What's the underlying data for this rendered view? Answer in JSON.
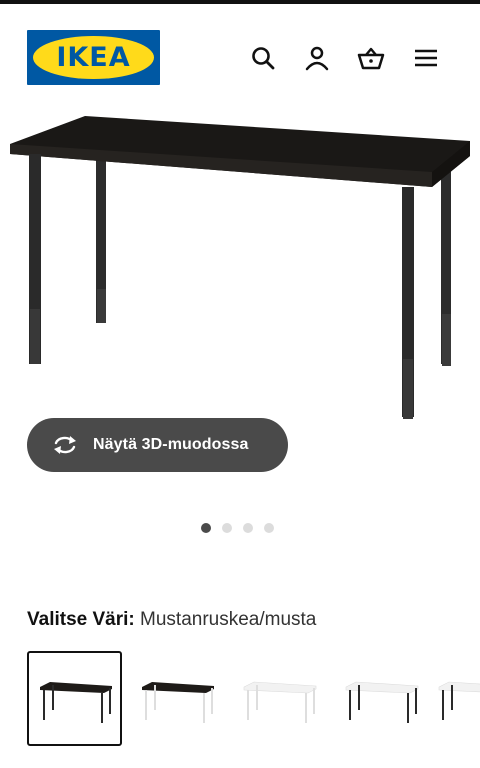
{
  "header": {
    "logo_text": "IKEA",
    "icons": [
      "search-icon",
      "user-icon",
      "basket-icon",
      "menu-icon"
    ],
    "brand_blue": "#0058a3",
    "brand_yellow": "#ffda1a"
  },
  "gallery": {
    "view_3d_label": "Näytä 3D-muodossa",
    "image_count": 4,
    "active_index": 0
  },
  "color_selector": {
    "label": "Valitse Väri:",
    "value": "Mustanruskea/musta",
    "variants": [
      {
        "top": "#1e1b18",
        "legs": "#2a2a2a",
        "selected": true
      },
      {
        "top": "#1e1b18",
        "legs": "#e6e6e6",
        "selected": false
      },
      {
        "top": "#f4f4f4",
        "legs": "#e6e6e6",
        "selected": false
      },
      {
        "top": "#f4f4f4",
        "legs": "#2a2a2a",
        "selected": false
      },
      {
        "top": "#f4f4f4",
        "legs": "#2a2a2a",
        "selected": false
      }
    ]
  }
}
